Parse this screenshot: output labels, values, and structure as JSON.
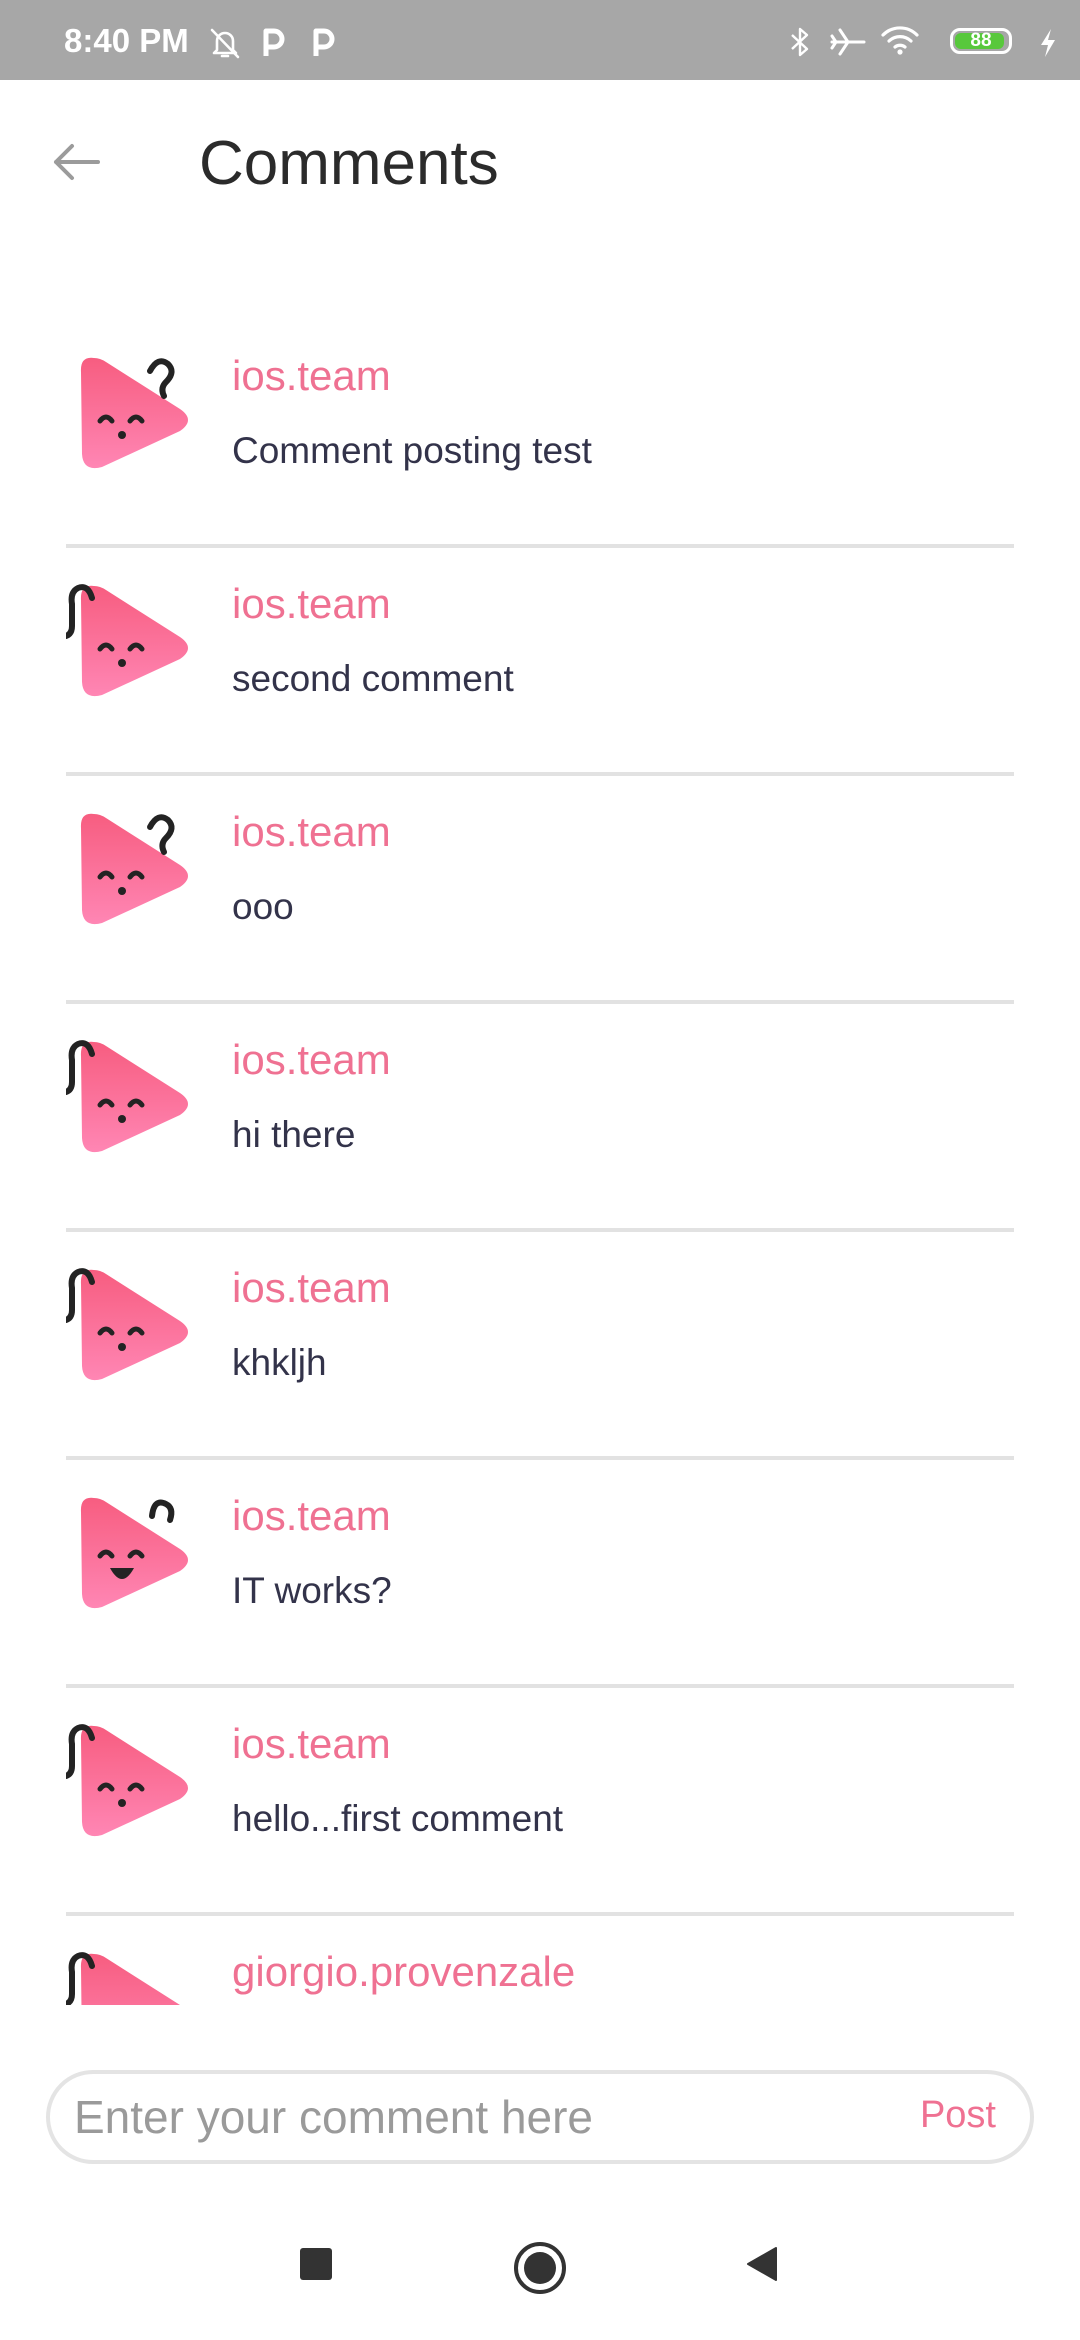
{
  "status_bar": {
    "time": "8:40 PM",
    "left_icons": [
      "bell-off-icon",
      "parking-icon",
      "parking-icon"
    ],
    "right_icons": [
      "bluetooth-icon",
      "airplane-icon",
      "wifi-icon",
      "battery-icon",
      "charging-icon"
    ],
    "battery_level": "88",
    "battery_color": "#58c83c"
  },
  "header": {
    "back_icon": "arrow-left-icon",
    "title": "Comments"
  },
  "comments": [
    {
      "author": "ios.team",
      "text": "Comment posting test",
      "avatar_icon": "strawberry-sleepy-icon"
    },
    {
      "author": "ios.team",
      "text": "second comment",
      "avatar_icon": "strawberry-curl-icon"
    },
    {
      "author": "ios.team",
      "text": "ooo",
      "avatar_icon": "strawberry-sleepy-icon"
    },
    {
      "author": "ios.team",
      "text": "hi there",
      "avatar_icon": "strawberry-curl-icon"
    },
    {
      "author": "ios.team",
      "text": "khkljh",
      "avatar_icon": "strawberry-curl-icon"
    },
    {
      "author": "ios.team",
      "text": "IT works?",
      "avatar_icon": "strawberry-smile-icon"
    },
    {
      "author": "ios.team",
      "text": "hello...first comment",
      "avatar_icon": "strawberry-curl-icon"
    },
    {
      "author": "giorgio.provenzale",
      "text": "",
      "avatar_icon": "strawberry-curl-icon"
    }
  ],
  "input": {
    "placeholder": "Enter your comment here",
    "value": "",
    "post_label": "Post"
  },
  "nav_bar": {
    "icons": [
      "recents-square-icon",
      "home-circle-icon",
      "back-triangle-icon"
    ]
  },
  "colors": {
    "accent": "#ef7192",
    "avatar_gradient_top": "#f75d80",
    "avatar_gradient_bottom": "#ff86b4",
    "text": "#33334a",
    "status_bar": "#a7a7a7"
  }
}
